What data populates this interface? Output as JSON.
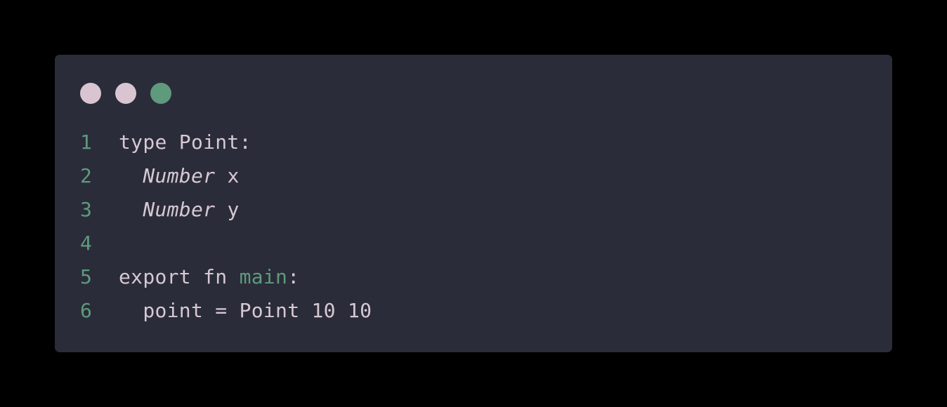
{
  "colors": {
    "background": "#000000",
    "window_bg": "#2a2c39",
    "line_number": "#5f9a7c",
    "text": "#d7c8d3",
    "function_name": "#5f9a7c",
    "dot_1": "#d9c5d1",
    "dot_2": "#d9c5d1",
    "dot_3": "#5f9a7c"
  },
  "window_controls": [
    {
      "name": "window-dot-1",
      "icon": "circle-icon"
    },
    {
      "name": "window-dot-2",
      "icon": "circle-icon"
    },
    {
      "name": "window-dot-3",
      "icon": "circle-icon"
    }
  ],
  "code": {
    "lines": [
      {
        "number": "1",
        "tokens": [
          {
            "text": "type Point:",
            "kind": "plain"
          }
        ]
      },
      {
        "number": "2",
        "tokens": [
          {
            "text": "  ",
            "kind": "plain"
          },
          {
            "text": "Number",
            "kind": "type"
          },
          {
            "text": " x",
            "kind": "plain"
          }
        ]
      },
      {
        "number": "3",
        "tokens": [
          {
            "text": "  ",
            "kind": "plain"
          },
          {
            "text": "Number",
            "kind": "type"
          },
          {
            "text": " y",
            "kind": "plain"
          }
        ]
      },
      {
        "number": "4",
        "tokens": []
      },
      {
        "number": "5",
        "tokens": [
          {
            "text": "export fn ",
            "kind": "plain"
          },
          {
            "text": "main",
            "kind": "function"
          },
          {
            "text": ":",
            "kind": "plain"
          }
        ]
      },
      {
        "number": "6",
        "tokens": [
          {
            "text": "  point = Point 10 10",
            "kind": "plain"
          }
        ]
      }
    ]
  }
}
